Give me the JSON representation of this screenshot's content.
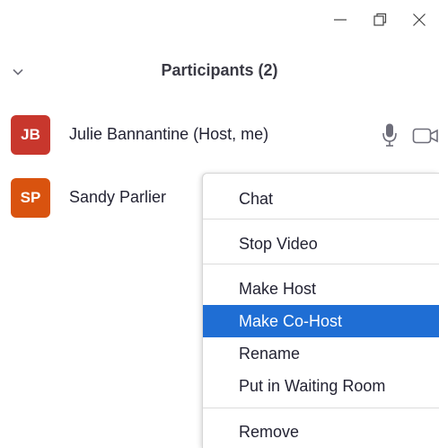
{
  "window_controls": {
    "minimize_icon": "minimize-icon",
    "restore_icon": "restore-icon",
    "close_icon": "close-icon"
  },
  "header": {
    "title": "Participants (2)",
    "chevron_icon": "chevron-down-icon"
  },
  "participants": [
    {
      "initials": "JB",
      "name": "Julie Bannantine (Host, me)",
      "avatar_color": "#c8372d",
      "mic_icon": "microphone-icon",
      "video_icon": "video-camera-icon"
    },
    {
      "initials": "SP",
      "name": "Sandy Parlier",
      "avatar_color": "#d9530f"
    }
  ],
  "context_menu": {
    "items": [
      {
        "label": "Chat"
      },
      {
        "label": "Stop Video"
      },
      {
        "label": "Make Host"
      },
      {
        "label": "Make Co-Host",
        "highlighted": true
      },
      {
        "label": "Rename"
      },
      {
        "label": "Put in Waiting Room"
      },
      {
        "label": "Remove"
      }
    ],
    "highlight_color": "#1f6ed4"
  }
}
